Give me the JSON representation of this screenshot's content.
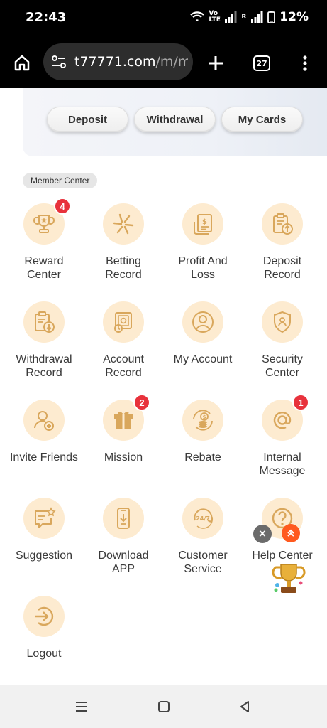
{
  "status_bar": {
    "time": "22:43",
    "network_label": "Vo\nLTE",
    "roaming_label": "R",
    "battery": "12%"
  },
  "browser": {
    "url_host": "t77771.com",
    "url_path": "/m/me",
    "tabs_count": "27",
    "icons": [
      "home-icon",
      "site-settings-icon",
      "new-tab-icon",
      "tab-switcher-icon",
      "more-menu-icon"
    ]
  },
  "wallet_buttons": {
    "deposit": "Deposit",
    "withdrawal": "Withdrawal",
    "my_cards": "My Cards"
  },
  "member_center": {
    "section_label": "Member Center",
    "items": [
      {
        "label": "Reward\nCenter",
        "icon": "trophy-icon",
        "badge": "4"
      },
      {
        "label": "Betting\nRecord",
        "icon": "betting-icon",
        "badge": ""
      },
      {
        "label": "Profit And\nLoss",
        "icon": "ledger-icon",
        "badge": ""
      },
      {
        "label": "Deposit\nRecord",
        "icon": "deposit-clipboard-icon",
        "badge": ""
      },
      {
        "label": "Withdrawal\nRecord",
        "icon": "withdrawal-clipboard-icon",
        "badge": ""
      },
      {
        "label": "Account\nRecord",
        "icon": "account-record-icon",
        "badge": ""
      },
      {
        "label": "My Account",
        "icon": "user-icon",
        "badge": ""
      },
      {
        "label": "Security\nCenter",
        "icon": "shield-icon",
        "badge": ""
      },
      {
        "label": "Invite Friends",
        "icon": "invite-user-icon",
        "badge": ""
      },
      {
        "label": "Mission",
        "icon": "gift-icon",
        "badge": "2"
      },
      {
        "label": "Rebate",
        "icon": "coins-icon",
        "badge": ""
      },
      {
        "label": "Internal\nMessage",
        "icon": "at-sign-icon",
        "badge": "1"
      },
      {
        "label": "Suggestion",
        "icon": "chat-star-icon",
        "badge": ""
      },
      {
        "label": "Download\nAPP",
        "icon": "phone-download-icon",
        "badge": ""
      },
      {
        "label": "Customer\nService",
        "icon": "support-24-7-icon",
        "badge": ""
      },
      {
        "label": "Help Center",
        "icon": "question-icon",
        "badge": ""
      },
      {
        "label": "Logout",
        "icon": "logout-icon",
        "badge": ""
      }
    ]
  },
  "floating": {
    "close_icon": "close-icon",
    "scroll_top_icon": "double-chevron-up-icon",
    "trophy_icon": "trophy-float-icon"
  },
  "nav_bar": {
    "icons": [
      "recents-icon",
      "home-square-icon",
      "back-icon"
    ]
  },
  "colors": {
    "accent_icon": "#d9a75c",
    "icon_bg": "#fdebd0",
    "badge": "#e8323c",
    "scroll_top": "#ff5a1f"
  }
}
